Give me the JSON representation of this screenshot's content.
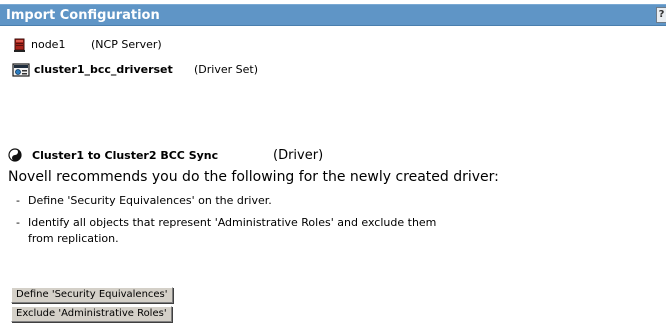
{
  "header": {
    "title": "Import Configuration",
    "help_icon": "help-icon",
    "help_glyph": "?"
  },
  "tree": {
    "node": {
      "name": "node1",
      "type": "(NCP Server)",
      "icon": "server-icon"
    },
    "driverset": {
      "name": "cluster1_bcc_driverset",
      "type": "(Driver Set)",
      "icon": "driver-set-icon"
    }
  },
  "driver": {
    "name": "Cluster1 to Cluster2 BCC Sync",
    "type": "(Driver)",
    "icon": "driver-icon"
  },
  "recommendation": {
    "intro": "Novell recommends you do the following for the newly created driver:",
    "items": [
      "Define 'Security Equivalences' on the driver.",
      "Identify all objects that represent 'Administrative Roles' and exclude them from replication."
    ]
  },
  "actions": {
    "define_label": "Define 'Security Equivalences'",
    "exclude_label": "Exclude 'Administrative Roles'"
  },
  "colors": {
    "titlebar": "#5f95c6",
    "button_face": "#d4d0c8"
  }
}
